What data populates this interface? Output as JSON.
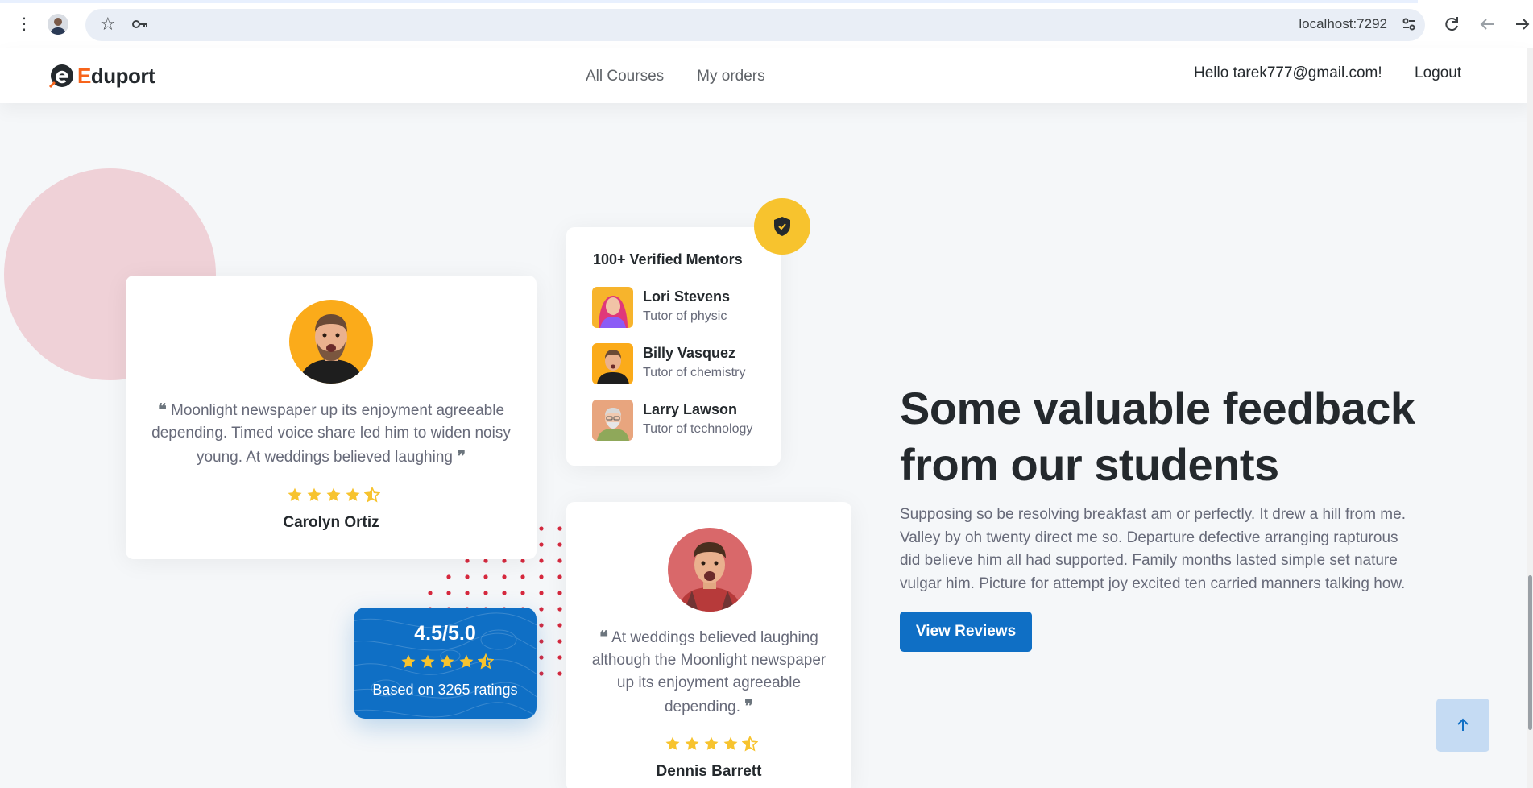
{
  "browser": {
    "url": "localhost:7292",
    "icons": [
      "more-vert-icon",
      "profile-avatar",
      "bookmark-star-icon",
      "password-key-icon",
      "site-settings-icon",
      "reload-icon",
      "back-arrow-icon",
      "forward-arrow-icon"
    ]
  },
  "header": {
    "logo_letter": "E",
    "logo_rest": "duport",
    "nav": [
      {
        "label": "All Courses"
      },
      {
        "label": "My orders"
      }
    ],
    "greeting": "Hello tarek777@gmail.com!",
    "logout": "Logout"
  },
  "testimonial_1": {
    "quote": "Moonlight newspaper up its enjoyment agreeable depending. Timed voice share led him to widen noisy young. At weddings believed laughing",
    "name": "Carolyn Ortiz",
    "stars": 4.5
  },
  "mentors": {
    "title": "100+ Verified Mentors",
    "badge_icon": "shield-check-icon",
    "list": [
      {
        "name": "Lori Stevens",
        "role": "Tutor of physic"
      },
      {
        "name": "Billy Vasquez",
        "role": "Tutor of chemistry"
      },
      {
        "name": "Larry Lawson",
        "role": "Tutor of technology"
      }
    ]
  },
  "rating_card": {
    "score": "4.5/5.0",
    "stars": 4.5,
    "based_on": "Based on 3265 ratings"
  },
  "testimonial_2": {
    "quote": "At weddings believed laughing although the Moonlight newspaper up its enjoyment agreeable depending.",
    "name": "Dennis Barrett",
    "stars": 4.5
  },
  "section": {
    "headline": "Some valuable feedback from our students",
    "description": "Supposing so be resolving breakfast am or perfectly. It drew a hill from me. Valley by oh twenty direct me so. Departure defective arranging rapturous did believe him all had supported. Family months lasted simple set nature vulgar him. Picture for attempt joy excited ten carried manners talking how.",
    "button": "View Reviews"
  },
  "colors": {
    "primary": "#0f6fc5",
    "accent_orange": "#f7641b",
    "star_yellow": "#f7c32e",
    "pink_circle": "#efd1d7",
    "dot_red": "#d6293e"
  },
  "back_to_top_icon": "arrow-up-icon"
}
